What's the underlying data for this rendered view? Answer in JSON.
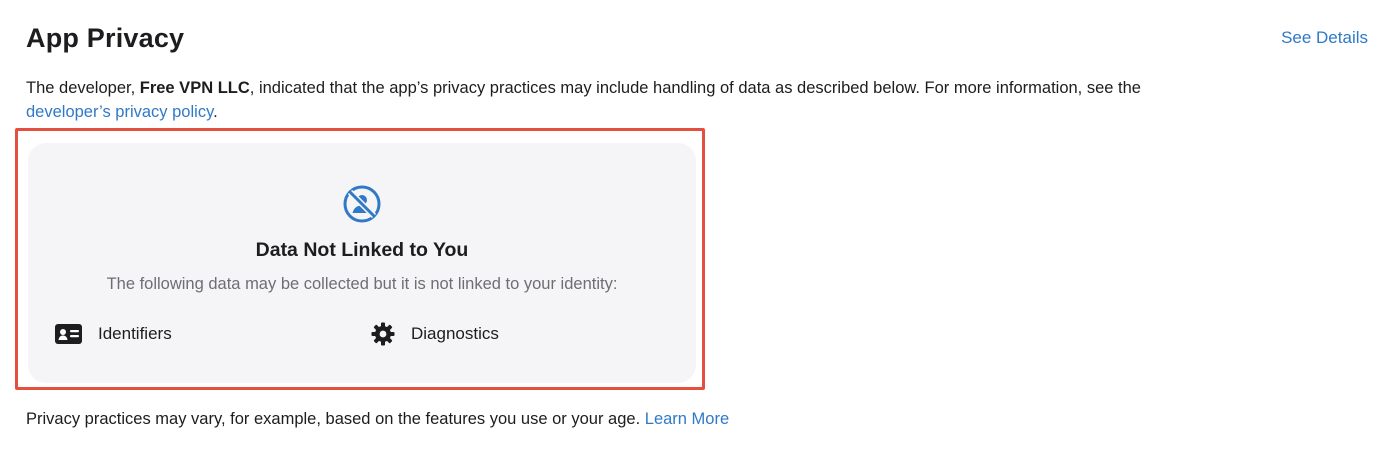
{
  "header": {
    "title": "App Privacy",
    "see_details": "See Details"
  },
  "intro": {
    "prefix": "The developer, ",
    "developer": "Free VPN LLC",
    "middle": ", indicated that the app’s privacy practices may include handling of data as described below. For more information, see the",
    "policy_link": "developer’s privacy policy",
    "suffix": "."
  },
  "card": {
    "icon": "person-slash-circle-icon",
    "title": "Data Not Linked to You",
    "subtitle": "The following data may be collected but it is not linked to your identity:",
    "items": [
      {
        "icon": "id-card-icon",
        "label": "Identifiers"
      },
      {
        "icon": "gear-icon",
        "label": "Diagnostics"
      }
    ]
  },
  "footer": {
    "text": "Privacy practices may vary, for example, based on the features you use or your age.",
    "link": "Learn More"
  },
  "colors": {
    "link": "#2f79c7",
    "highlight": "#e4503d",
    "card_bg": "#f5f5f7"
  }
}
